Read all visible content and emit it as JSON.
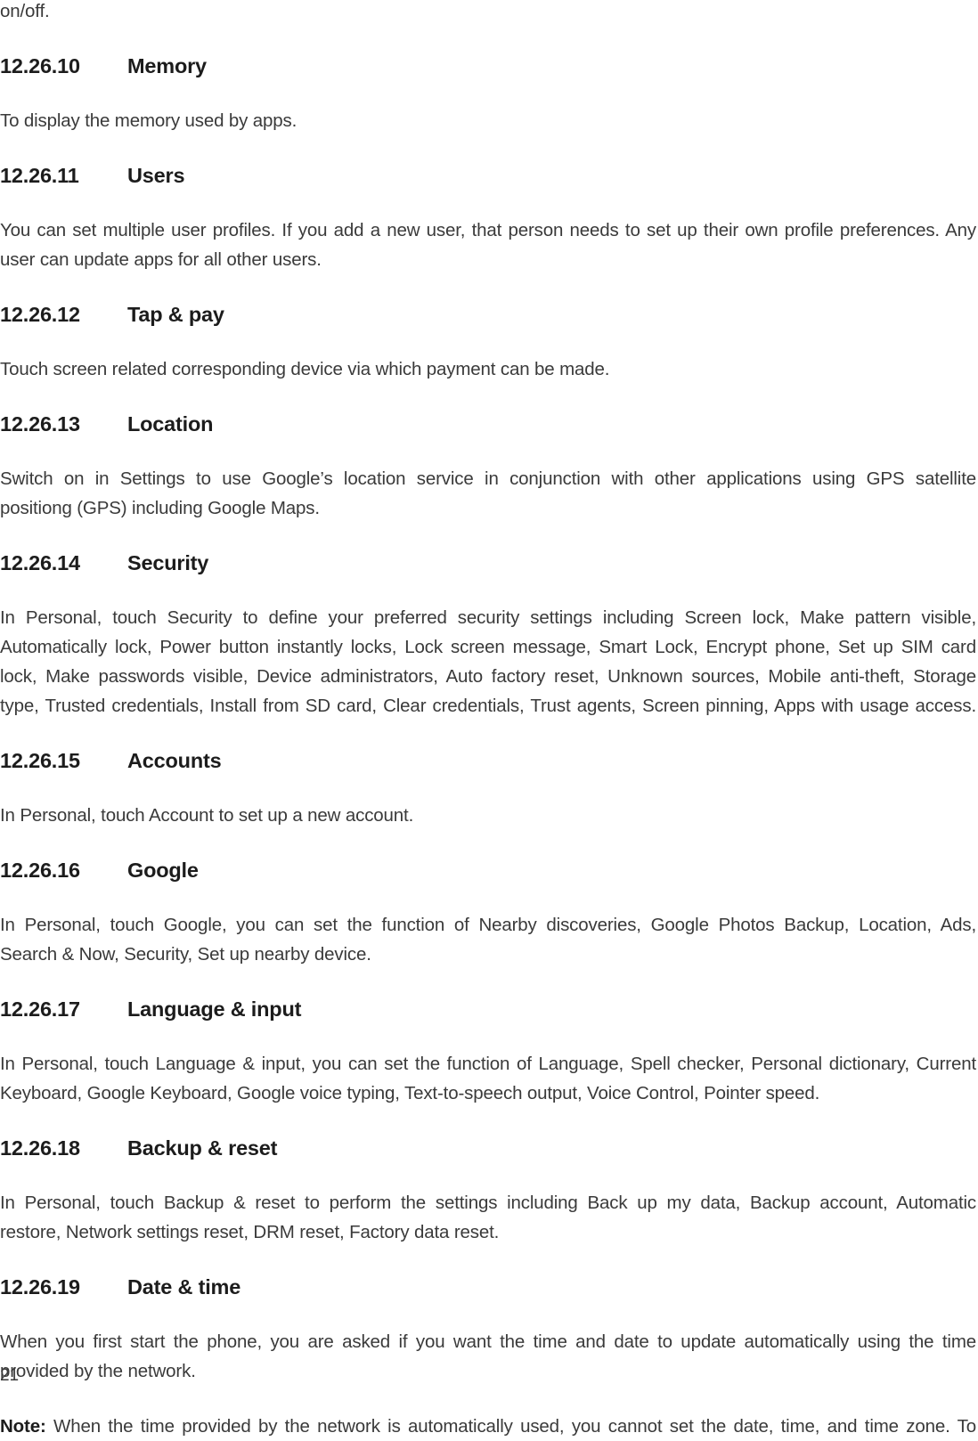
{
  "page": {
    "number": "21",
    "continued_text": "on/off."
  },
  "sections": [
    {
      "number": "12.26.10",
      "title": "Memory",
      "body": "To display the memory used by apps."
    },
    {
      "number": "12.26.11",
      "title": "Users",
      "body": "You can set multiple user profiles. If you add a new user, that person needs to set up their own profile preferences. Any user can update apps for all other users.",
      "line1": "You can set multiple user profiles. If you add a new user, that person needs to set up their own profile preferences. Any",
      "line2": "user can update apps for all other users."
    },
    {
      "number": "12.26.12",
      "title": "Tap & pay",
      "body": "Touch screen related corresponding device via which payment can be made."
    },
    {
      "number": "12.26.13",
      "title": "Location",
      "body": "Switch on in Settings to use Google’s location service in conjunction with other applications using GPS satellite positiong (GPS) including Google Maps.",
      "line1": "Switch on in Settings to use Google’s location service in conjunction with other applications using GPS satellite",
      "line2": "positiong (GPS) including Google Maps."
    },
    {
      "number": "12.26.14",
      "title": "Security",
      "body": "In Personal, touch Security to define your preferred security settings including Screen lock, Make pattern visible, Automatically lock, Power button instantly locks, Lock screen message, Smart Lock, Encrypt phone, Set up SIM card lock, Make passwords visible, Device administrators, Auto factory reset, Unknown sources, Mobile anti-theft, Storage type, Trusted credentials, Install from SD card, Clear credentials, Trust agents, Screen pinning, Apps with usage access.",
      "line1": "In Personal, touch Security to define your preferred security settings including Screen lock, Make pattern visible,",
      "line2": "Automatically lock, Power button instantly locks, Lock screen message, Smart Lock, Encrypt phone, Set up SIM card",
      "line3": "lock, Make passwords visible, Device administrators, Auto factory reset, Unknown sources, Mobile anti-theft, Storage",
      "line4": "type, Trusted credentials, Install from SD card, Clear credentials, Trust agents, Screen pinning, Apps with usage access."
    },
    {
      "number": "12.26.15",
      "title": "Accounts",
      "body": "In Personal, touch Account to set up a new account."
    },
    {
      "number": "12.26.16",
      "title": "Google",
      "body": "In Personal, touch Google, you can set the function of Nearby discoveries, Google Photos Backup, Location, Ads, Search & Now, Security, Set up nearby device.",
      "line1": "In Personal, touch Google, you can set the function of Nearby discoveries, Google Photos Backup, Location, Ads,",
      "line2": "Search & Now, Security, Set up nearby device."
    },
    {
      "number": "12.26.17",
      "title": "Language & input",
      "body": "In Personal, touch Language & input, you can set the function of Language, Spell checker, Personal dictionary, Current Keyboard, Google Keyboard, Google voice typing, Text-to-speech output, Voice Control, Pointer speed.",
      "line1": "In Personal, touch Language & input, you can set the function of Language, Spell checker, Personal dictionary, Current",
      "line2": "Keyboard, Google Keyboard, Google voice typing, Text-to-speech output, Voice Control, Pointer speed."
    },
    {
      "number": "12.26.18",
      "title": "Backup & reset",
      "body": "In Personal, touch Backup & reset to perform the settings including Back up my data, Backup account, Automatic restore, Network settings reset, DRM reset, Factory data reset.",
      "line1": "In Personal, touch Backup & reset to perform the settings including Back up my data, Backup account, Automatic",
      "line2": "restore, Network settings reset, DRM reset, Factory data reset."
    },
    {
      "number": "12.26.19",
      "title": "Date & time",
      "body": "When you first start the phone, you are asked if you want the time and date to update automatically using the time provided by the network.",
      "line1": "When you first start the phone, you are asked if you want the time and date to update automatically using the time",
      "line2": "provided by the network."
    }
  ],
  "note": {
    "label": "Note:",
    "text": "When the time provided by the network is automatically used, you cannot set the date, time, and time zone. To"
  }
}
